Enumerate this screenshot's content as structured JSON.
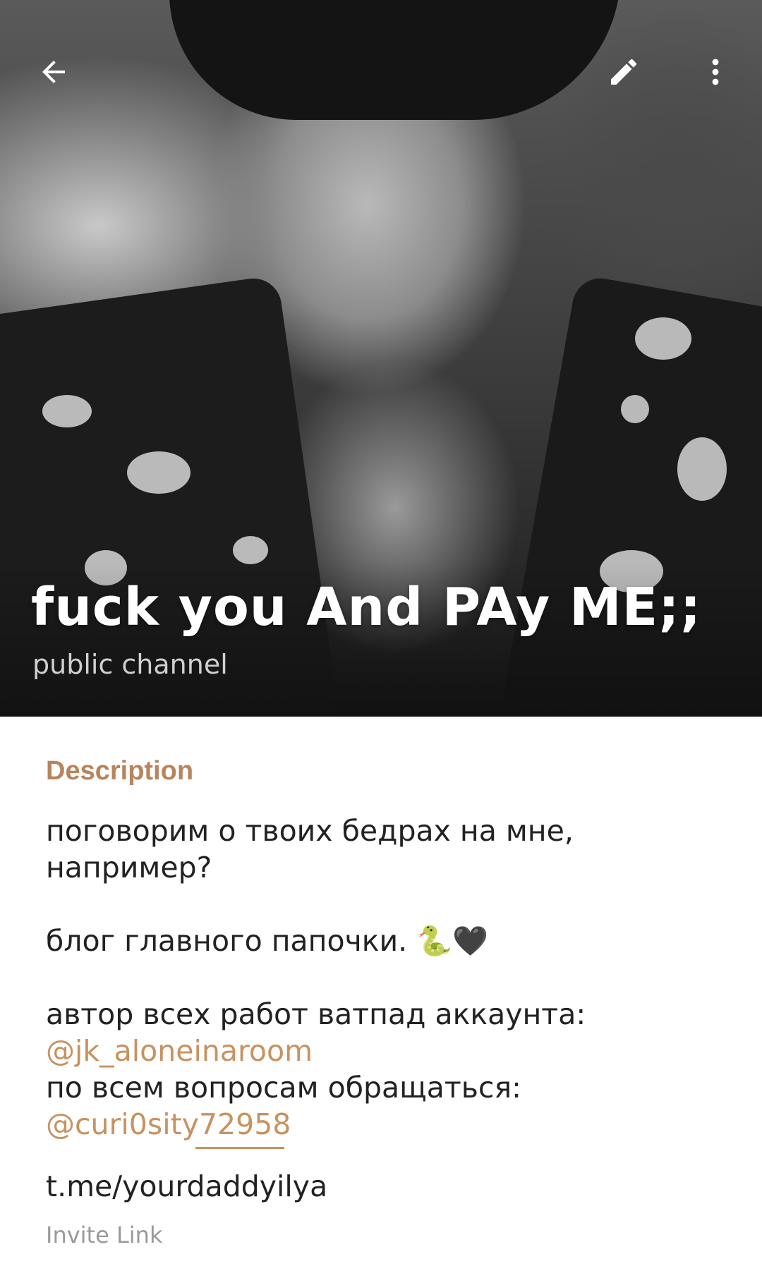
{
  "header": {
    "title": "fuck you And PAy ME;;",
    "subtitle": "public channel"
  },
  "toolbar": {
    "back_icon": "arrow-left-icon",
    "edit_icon": "pencil-icon",
    "more_icon": "more-vertical-icon"
  },
  "description": {
    "label": "Description",
    "line1": "поговорим о твоих бедрах на мне,",
    "line2": "например?",
    "line3": "блог главного папочки. 🐍🖤",
    "line4": "автор всех работ ватпад аккаунта:",
    "mention1": "@jk_aloneinaroom",
    "line5": "по всем вопросам обращаться:",
    "mention2": "@curi0sity72958"
  },
  "invite": {
    "link": "t.me/yourdaddyilya",
    "label": "Invite Link"
  },
  "colors": {
    "accent": "#c8925f",
    "text": "#222222",
    "muted": "#9a9a9a"
  }
}
